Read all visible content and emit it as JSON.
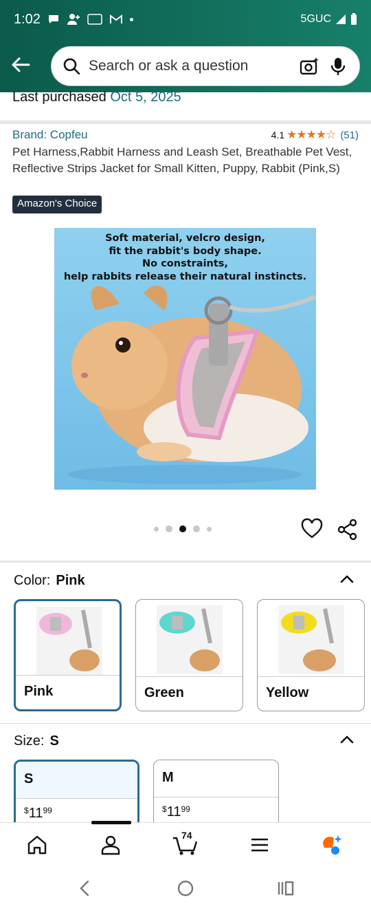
{
  "status": {
    "time": "1:02",
    "network": "5GUC"
  },
  "search": {
    "placeholder": "Search or ask a question"
  },
  "last_purchased": {
    "label": "Last purchased",
    "date": "Oct 5, 2025"
  },
  "product": {
    "brand": "Brand: Copfeu",
    "rating": "4.1",
    "stars": "★★★★☆",
    "review_count": "(51)",
    "title": "Pet Harness,Rabbit Harness and Leash Set, Breathable Pet Vest, Reflective Strips Jacket for Small Kitten, Puppy, Rabbit (Pink,S)",
    "badge": "Amazon's Choice",
    "image_caption_lines": [
      "Soft material, velcro design,",
      "fit the rabbit's body shape.",
      "No constraints,",
      "help rabbits release their natural instincts."
    ],
    "image_dots": 5,
    "image_active_index": 2
  },
  "color": {
    "label": "Color:",
    "selected": "Pink",
    "options": [
      {
        "name": "Pink",
        "tint": "#f3b6d9"
      },
      {
        "name": "Green",
        "tint": "#5fd6cf"
      },
      {
        "name": "Yellow",
        "tint": "#f2dc1e"
      }
    ]
  },
  "size": {
    "label": "Size:",
    "selected": "S",
    "options": [
      {
        "name": "S",
        "dollars": "11",
        "cents": "99",
        "currency": "$"
      },
      {
        "name": "M",
        "dollars": "11",
        "cents": "99",
        "currency": "$"
      }
    ]
  },
  "bottom_nav": {
    "cart_count": "74"
  },
  "colors": {
    "header": "#0b5a4a",
    "link": "#1b6e84",
    "selected_border": "#2b6a8e",
    "star": "#de7921"
  }
}
